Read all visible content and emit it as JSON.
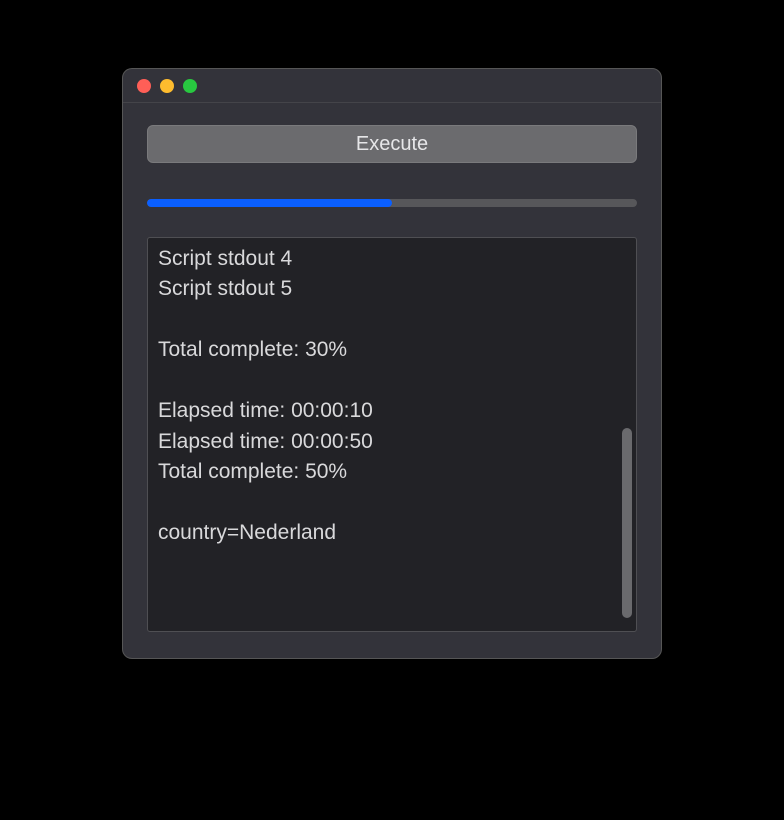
{
  "buttons": {
    "execute_label": "Execute"
  },
  "progress": {
    "percent": 50
  },
  "output_lines": [
    "Script stdout 4",
    "Script stdout 5",
    "",
    "Total complete: 30%",
    "",
    "Elapsed time: 00:00:10",
    "Elapsed time: 00:00:50",
    "Total complete: 50%",
    "",
    "country=Nederland"
  ]
}
